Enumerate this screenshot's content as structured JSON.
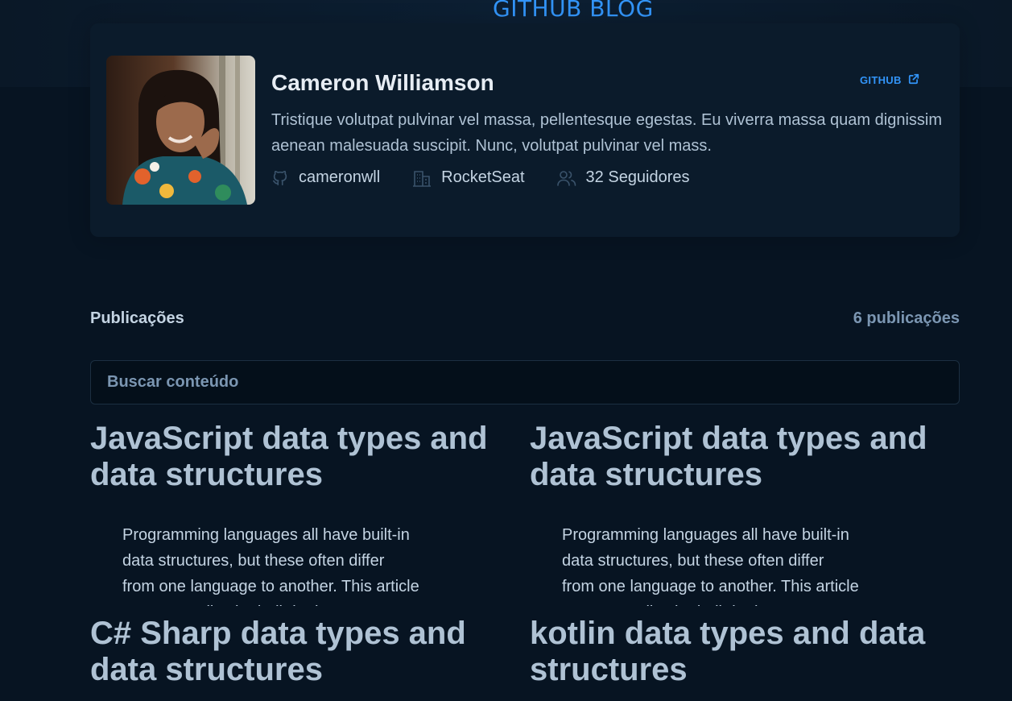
{
  "header": {
    "logo_text": "GITHUB BLOG"
  },
  "profile": {
    "name": "Cameron Williamson",
    "github_label": "GITHUB",
    "bio": "Tristique volutpat pulvinar vel massa, pellentesque egestas. Eu viverra massa quam dignissim aenean malesuada suscipit. Nunc, volutpat pulvinar vel mass.",
    "username": "cameronwll",
    "company": "RocketSeat",
    "followers": "32 Seguidores"
  },
  "publications": {
    "title": "Publicações",
    "count": "6 publicações"
  },
  "search": {
    "placeholder": "Buscar conteúdo"
  },
  "posts": [
    {
      "title": "JavaScript data types and data structures",
      "excerpt": "Programming languages all have built-in data structures, but these often differ from one language to another. This article attempts to list the built-in data"
    },
    {
      "title": "JavaScript data types and data structures",
      "excerpt": "Programming languages all have built-in data structures, but these often differ from one language to another. This article attempts to list the built-in data"
    },
    {
      "title": "C# Sharp data types and data structures",
      "excerpt": ""
    },
    {
      "title": "kotlin data types and data structures",
      "excerpt": ""
    }
  ],
  "colors": {
    "background": "#071422",
    "card": "#0b1b2b",
    "brand_blue": "#3294f8",
    "title_text": "#e7edf4",
    "body_text": "#afc2d4"
  },
  "icons": {
    "github": "github-icon",
    "company": "building-icon",
    "followers": "users-icon",
    "external_link": "external-link-icon"
  }
}
